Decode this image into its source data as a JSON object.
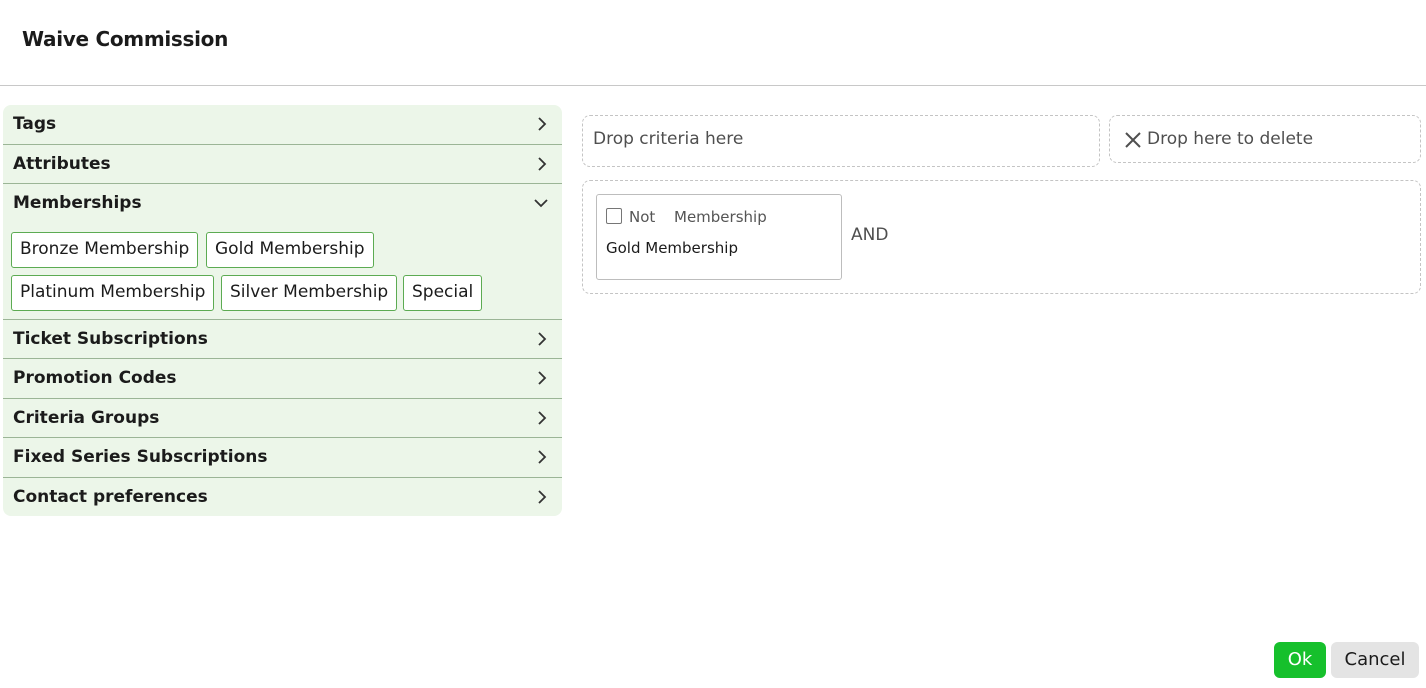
{
  "dialog": {
    "title": "Waive Commission"
  },
  "sidebar": {
    "sections": [
      {
        "label": "Tags",
        "expanded": false
      },
      {
        "label": "Attributes",
        "expanded": false
      },
      {
        "label": "Memberships",
        "expanded": true,
        "items": [
          "Bronze Membership",
          "Gold Membership",
          "Platinum Membership",
          "Silver Membership",
          "Special"
        ]
      },
      {
        "label": "Ticket Subscriptions",
        "expanded": false
      },
      {
        "label": "Promotion Codes",
        "expanded": false
      },
      {
        "label": "Criteria Groups",
        "expanded": false
      },
      {
        "label": "Fixed Series Subscriptions",
        "expanded": false
      },
      {
        "label": "Contact preferences",
        "expanded": false
      }
    ]
  },
  "drop_zones": {
    "criteria_label": "Drop criteria here",
    "delete_label": "Drop here to delete",
    "delete_icon": "close-icon"
  },
  "criteria": {
    "card": {
      "not_label": "Not",
      "not_checked": false,
      "type": "Membership",
      "value": "Gold Membership"
    },
    "operator": "AND"
  },
  "actions": {
    "ok_label": "Ok",
    "cancel_label": "Cancel"
  },
  "colors": {
    "panel_bg": "#ecf6e9",
    "chip_border": "#5cab52",
    "ok_bg": "#16c02c",
    "cancel_bg": "#e4e4e4"
  }
}
